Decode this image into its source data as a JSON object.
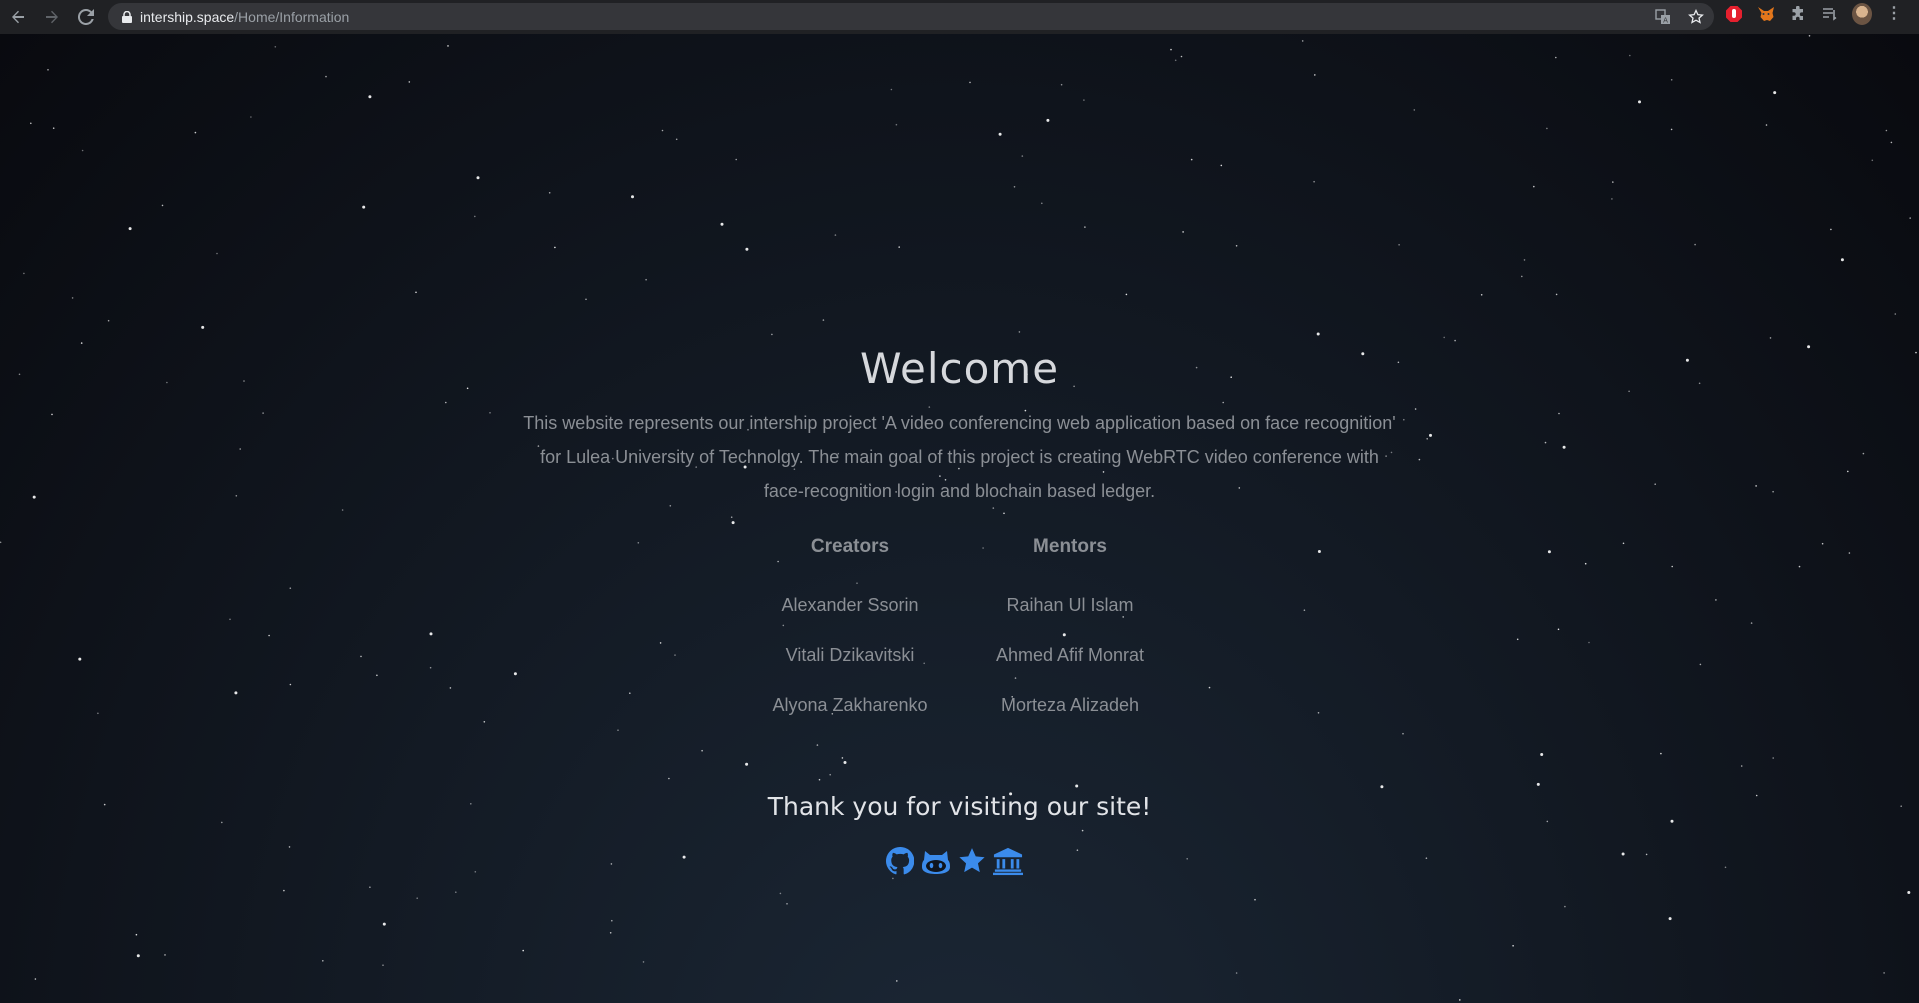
{
  "browser": {
    "url_host": "intership.space",
    "url_path": "/Home/Information"
  },
  "page": {
    "title": "Welcome",
    "description": "This website represents our intership project 'A video conferencing web application based on face recognition' for Lulea University of Technolgy. The main goal of this project is creating WebRTC video conference with face-recognition login and blochain based ledger.",
    "creators_heading": "Creators",
    "mentors_heading": "Mentors",
    "creators": [
      "Alexander Ssorin",
      "Vitali Dzikavitski",
      "Alyona Zakharenko"
    ],
    "mentors": [
      "Raihan Ul Islam",
      "Ahmed Afif Monrat",
      "Morteza Alizadeh"
    ],
    "thanks": "Thank you for visiting our site!",
    "social_icons": [
      "github-icon",
      "gitlab-cat-icon",
      "star-icon",
      "university-icon"
    ]
  },
  "colors": {
    "accent": "#3b8beb",
    "text_muted": "#8b8f95",
    "heading": "#d6d8dc"
  }
}
